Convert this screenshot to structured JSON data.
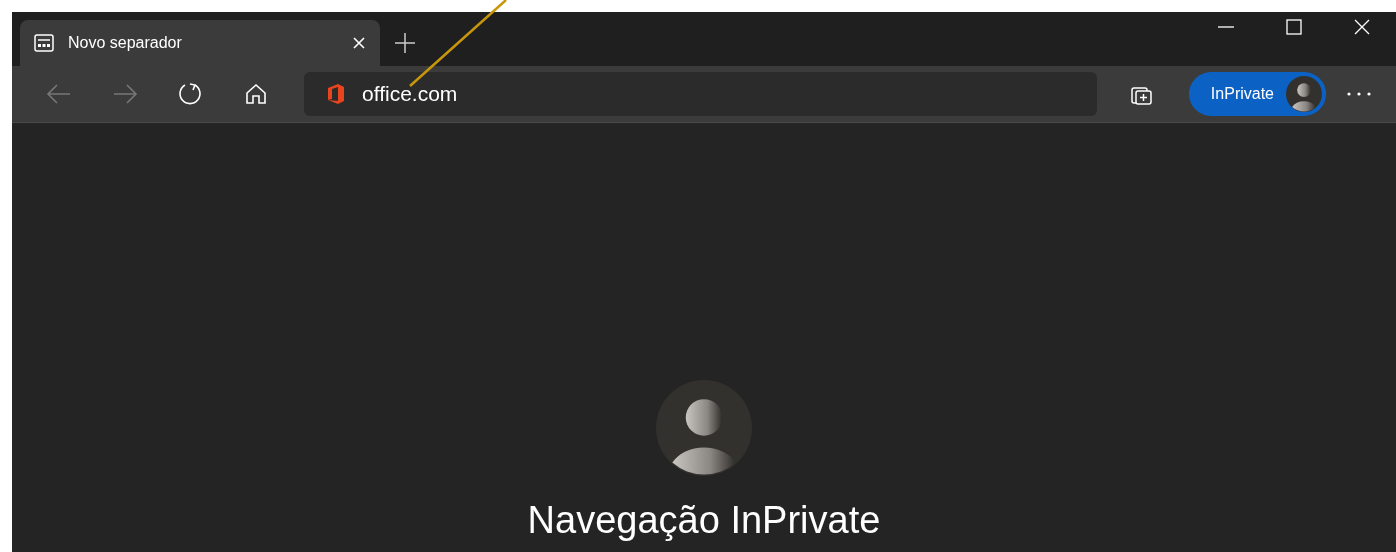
{
  "tabs": [
    {
      "title": "Novo separador",
      "selected": true
    }
  ],
  "toolbar": {
    "buttons": [
      {
        "kind": "back",
        "disabled": true
      },
      {
        "kind": "forward",
        "disabled": true
      },
      {
        "kind": "refresh",
        "disabled": false
      },
      {
        "kind": "home",
        "disabled": false
      }
    ]
  },
  "address_bar": {
    "value": "office.com"
  },
  "profile_button": {
    "label": "InPrivate"
  },
  "page": {
    "heading": "Navegação InPrivate"
  }
}
